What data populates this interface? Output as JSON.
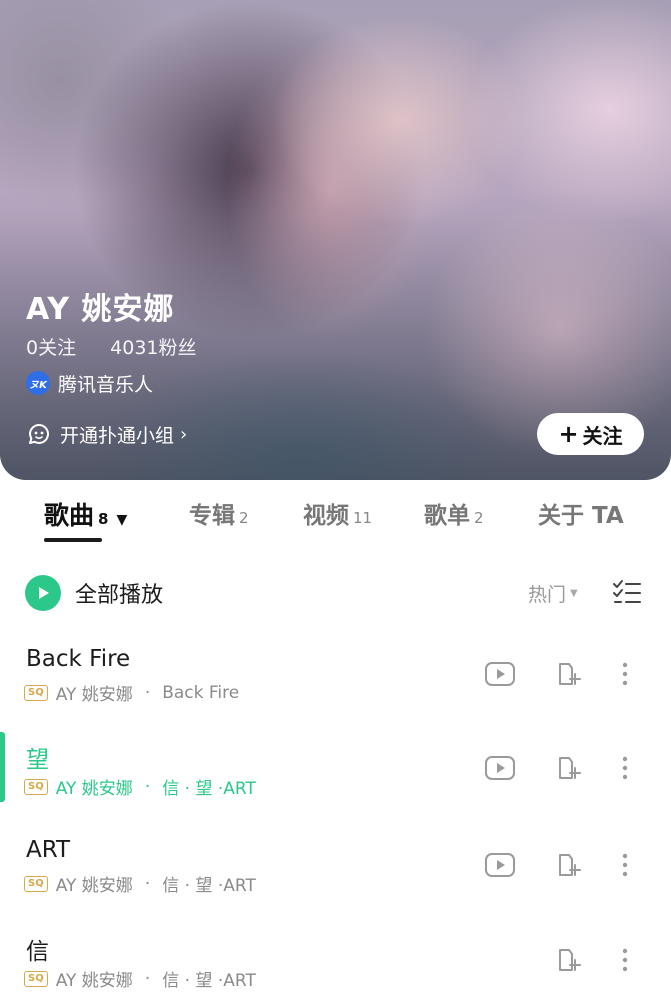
{
  "artist": {
    "name": "AY 姚安娜",
    "following": "0关注",
    "followers": "4031粉丝",
    "verification_badge": "腾讯音乐人",
    "badge_mark": "ヌK",
    "group_link": "开通扑通小组",
    "follow_button": "关注"
  },
  "tabs": [
    {
      "label": "歌曲",
      "count": "8",
      "active": true
    },
    {
      "label": "专辑",
      "count": "2"
    },
    {
      "label": "视频",
      "count": "11"
    },
    {
      "label": "歌单",
      "count": "2"
    },
    {
      "label": "关于 TA",
      "count": ""
    }
  ],
  "toolbar": {
    "play_all": "全部播放",
    "sort": "热门"
  },
  "songs": [
    {
      "title": "Back Fire",
      "quality": "SQ",
      "artist": "AY 姚安娜",
      "album": "Back Fire",
      "has_video": true,
      "playing": false
    },
    {
      "title": "望",
      "quality": "SQ",
      "artist": "AY 姚安娜",
      "album": "信 · 望 ·ART",
      "has_video": true,
      "playing": true
    },
    {
      "title": "ART",
      "quality": "SQ",
      "artist": "AY 姚安娜",
      "album": "信 · 望 ·ART",
      "has_video": true,
      "playing": false
    },
    {
      "title": "信",
      "quality": "SQ",
      "artist": "AY 姚安娜",
      "album": "信 · 望 ·ART",
      "has_video": false,
      "playing": false
    }
  ],
  "colors": {
    "accent": "#2bc88a",
    "quality_badge": "#d6a94a",
    "verify_badge": "#2f6ee6"
  }
}
